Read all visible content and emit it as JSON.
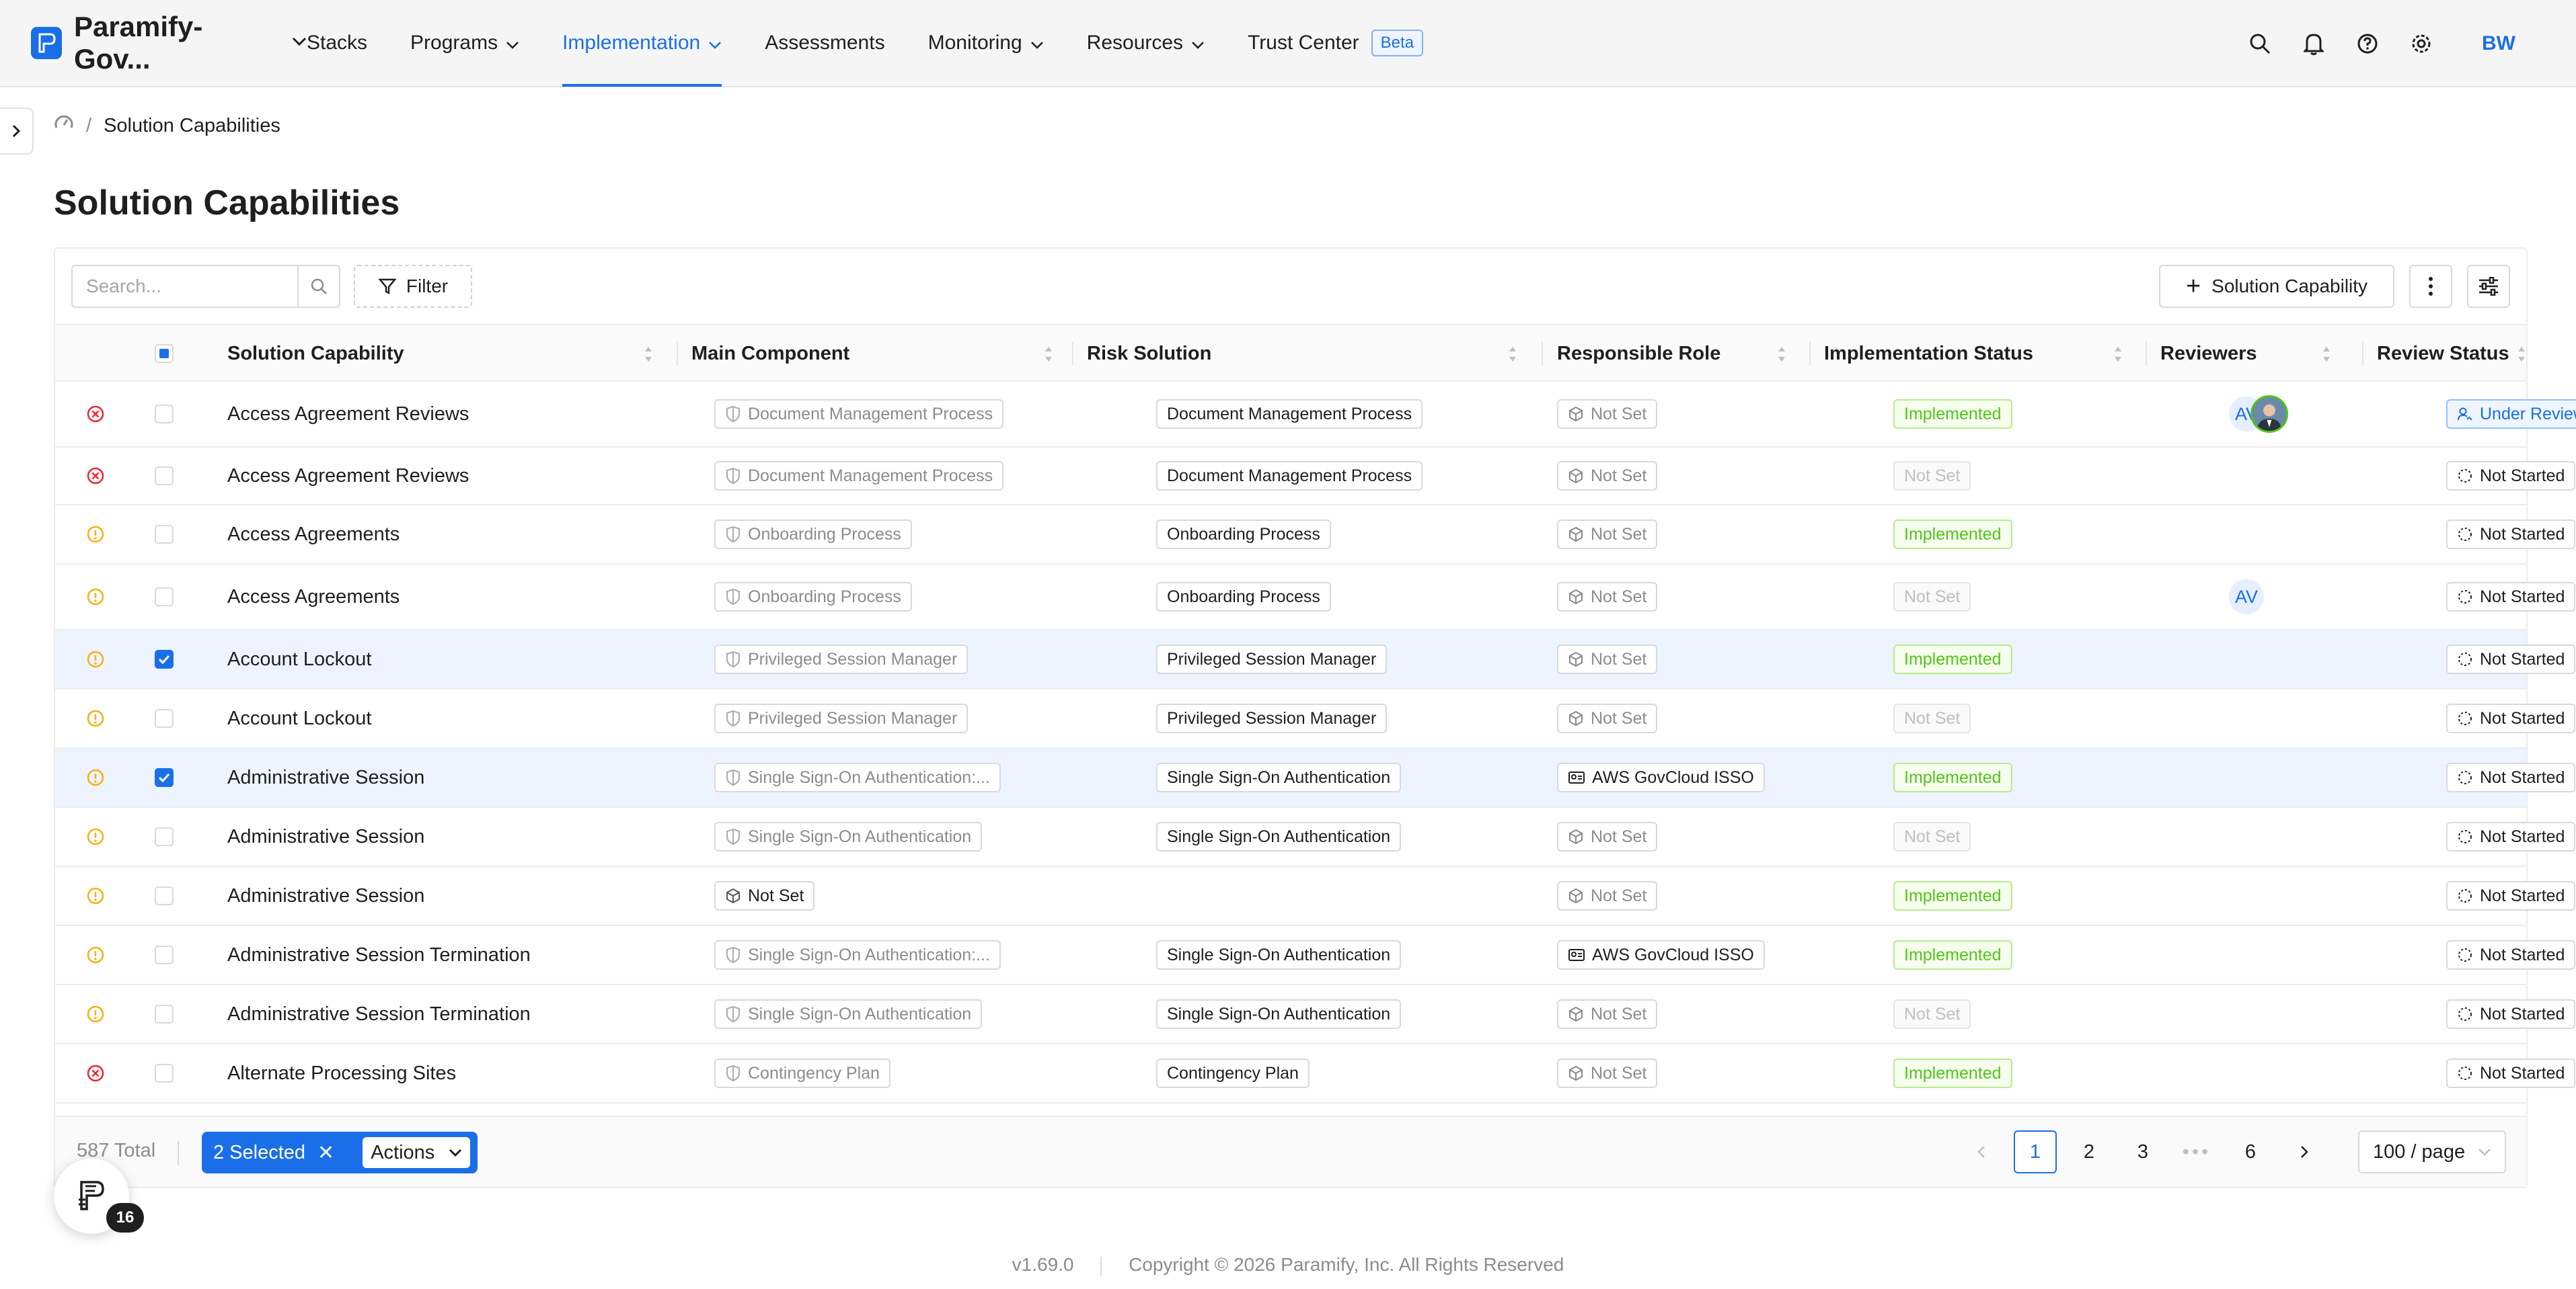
{
  "header": {
    "brand": "Paramify-Gov...",
    "nav": [
      {
        "label": "Stacks",
        "dropdown": false,
        "active": false
      },
      {
        "label": "Programs",
        "dropdown": true,
        "active": false
      },
      {
        "label": "Implementation",
        "dropdown": true,
        "active": true
      },
      {
        "label": "Assessments",
        "dropdown": false,
        "active": false
      },
      {
        "label": "Monitoring",
        "dropdown": true,
        "active": false
      },
      {
        "label": "Resources",
        "dropdown": true,
        "active": false
      },
      {
        "label": "Trust Center",
        "dropdown": false,
        "active": false,
        "badge": "Beta"
      }
    ],
    "icons": [
      "search-icon",
      "bell-icon",
      "help-icon",
      "gear-icon"
    ],
    "user_initials": "BW"
  },
  "breadcrumb": {
    "current": "Solution Capabilities"
  },
  "page_title": "Solution Capabilities",
  "toolbar": {
    "search_placeholder": "Search...",
    "filter_label": "Filter",
    "add_label": "Solution Capability"
  },
  "columns": [
    "Solution Capability",
    "Main Component",
    "Risk Solution",
    "Responsible Role",
    "Implementation Status",
    "Reviewers",
    "Review Status"
  ],
  "rows": [
    {
      "status": "error",
      "checked": false,
      "capability": "Access Agreement Reviews",
      "component": "Document Management Process",
      "component_icon": "shield",
      "risk": "Document Management Process",
      "role": "Not Set",
      "role_icon": "box",
      "impl": "Implemented",
      "reviewers": [
        "AV",
        "photo"
      ],
      "review": "Under Review"
    },
    {
      "status": "error",
      "checked": false,
      "capability": "Access Agreement Reviews",
      "component": "Document Management Process",
      "component_icon": "shield",
      "risk": "Document Management Process",
      "role": "Not Set",
      "role_icon": "box",
      "impl": "Not Set",
      "reviewers": [],
      "review": "Not Started"
    },
    {
      "status": "warning",
      "checked": false,
      "capability": "Access Agreements",
      "component": "Onboarding Process",
      "component_icon": "shield",
      "risk": "Onboarding Process",
      "role": "Not Set",
      "role_icon": "box",
      "impl": "Implemented",
      "reviewers": [],
      "review": "Not Started"
    },
    {
      "status": "warning",
      "checked": false,
      "capability": "Access Agreements",
      "component": "Onboarding Process",
      "component_icon": "shield",
      "risk": "Onboarding Process",
      "role": "Not Set",
      "role_icon": "box",
      "impl": "Not Set",
      "reviewers": [
        "AV"
      ],
      "review": "Not Started"
    },
    {
      "status": "warning",
      "checked": true,
      "capability": "Account Lockout",
      "component": "Privileged Session Manager",
      "component_icon": "shield",
      "risk": "Privileged Session Manager",
      "role": "Not Set",
      "role_icon": "box",
      "impl": "Implemented",
      "reviewers": [],
      "review": "Not Started"
    },
    {
      "status": "warning",
      "checked": false,
      "capability": "Account Lockout",
      "component": "Privileged Session Manager",
      "component_icon": "shield",
      "risk": "Privileged Session Manager",
      "role": "Not Set",
      "role_icon": "box",
      "impl": "Not Set",
      "reviewers": [],
      "review": "Not Started"
    },
    {
      "status": "warning",
      "checked": true,
      "capability": "Administrative Session",
      "component": "Single Sign-On Authentication:...",
      "component_icon": "shield",
      "risk": "Single Sign-On Authentication",
      "role": "AWS GovCloud ISSO",
      "role_icon": "card",
      "impl": "Implemented",
      "reviewers": [],
      "review": "Not Started"
    },
    {
      "status": "warning",
      "checked": false,
      "capability": "Administrative Session",
      "component": "Single Sign-On Authentication",
      "component_icon": "shield",
      "risk": "Single Sign-On Authentication",
      "role": "Not Set",
      "role_icon": "box",
      "impl": "Not Set",
      "reviewers": [],
      "review": "Not Started"
    },
    {
      "status": "warning",
      "checked": false,
      "capability": "Administrative Session",
      "component": "Not Set",
      "component_icon": "box",
      "risk": "",
      "role": "Not Set",
      "role_icon": "box",
      "impl": "Implemented",
      "reviewers": [],
      "review": "Not Started"
    },
    {
      "status": "warning",
      "checked": false,
      "capability": "Administrative Session Termination",
      "component": "Single Sign-On Authentication:...",
      "component_icon": "shield",
      "risk": "Single Sign-On Authentication",
      "role": "AWS GovCloud ISSO",
      "role_icon": "card",
      "impl": "Implemented",
      "reviewers": [],
      "review": "Not Started"
    },
    {
      "status": "warning",
      "checked": false,
      "capability": "Administrative Session Termination",
      "component": "Single Sign-On Authentication",
      "component_icon": "shield",
      "risk": "Single Sign-On Authentication",
      "role": "Not Set",
      "role_icon": "box",
      "impl": "Not Set",
      "reviewers": [],
      "review": "Not Started"
    },
    {
      "status": "error",
      "checked": false,
      "capability": "Alternate Processing Sites",
      "component": "Contingency Plan",
      "component_icon": "shield",
      "risk": "Contingency Plan",
      "role": "Not Set",
      "role_icon": "box",
      "impl": "Implemented",
      "reviewers": [],
      "review": "Not Started"
    }
  ],
  "footer": {
    "total": "587 Total",
    "selected": "2 Selected",
    "actions": "Actions",
    "pages": [
      "1",
      "2",
      "3",
      "6"
    ],
    "current_page": "1",
    "page_size": "100 / page"
  },
  "fab_badge": "16",
  "page_footer": {
    "version": "v1.69.0",
    "copyright": "Copyright © 2026 Paramify, Inc. All Rights Reserved"
  },
  "colors": {
    "accent": "#1a6fe8",
    "success": "#52c41a",
    "error": "#f5222d",
    "warning": "#faad14"
  }
}
